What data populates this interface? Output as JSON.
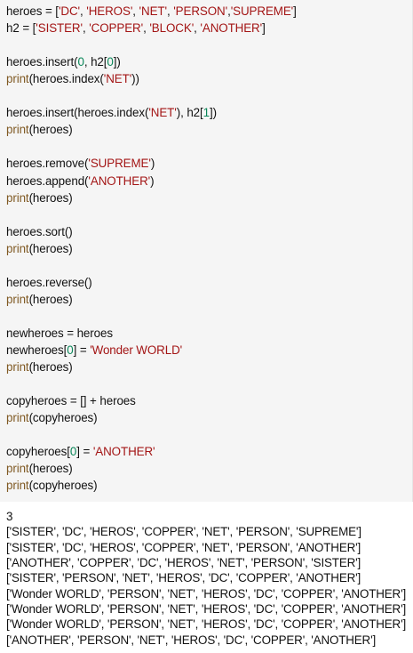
{
  "code": {
    "lines": [
      [
        {
          "t": "heroes = [",
          "c": "plain"
        },
        {
          "t": "'DC'",
          "c": "str"
        },
        {
          "t": ", ",
          "c": "plain"
        },
        {
          "t": "'HEROS'",
          "c": "str"
        },
        {
          "t": ", ",
          "c": "plain"
        },
        {
          "t": "'NET'",
          "c": "str"
        },
        {
          "t": ", ",
          "c": "plain"
        },
        {
          "t": "'PERSON'",
          "c": "str"
        },
        {
          "t": ",",
          "c": "plain"
        },
        {
          "t": "'SUPREME'",
          "c": "str"
        },
        {
          "t": "]",
          "c": "plain"
        }
      ],
      [
        {
          "t": "h2 = [",
          "c": "plain"
        },
        {
          "t": "'SISTER'",
          "c": "str"
        },
        {
          "t": ", ",
          "c": "plain"
        },
        {
          "t": "'COPPER'",
          "c": "str"
        },
        {
          "t": ", ",
          "c": "plain"
        },
        {
          "t": "'BLOCK'",
          "c": "str"
        },
        {
          "t": ", ",
          "c": "plain"
        },
        {
          "t": "'ANOTHER'",
          "c": "str"
        },
        {
          "t": "]",
          "c": "plain"
        }
      ],
      [],
      [
        {
          "t": "heroes.insert(",
          "c": "plain"
        },
        {
          "t": "0",
          "c": "num"
        },
        {
          "t": ", h2[",
          "c": "plain"
        },
        {
          "t": "0",
          "c": "num"
        },
        {
          "t": "])",
          "c": "plain"
        }
      ],
      [
        {
          "t": "print",
          "c": "fn"
        },
        {
          "t": "(heroes.index(",
          "c": "plain"
        },
        {
          "t": "'NET'",
          "c": "str"
        },
        {
          "t": "))",
          "c": "plain"
        }
      ],
      [],
      [
        {
          "t": "heroes.insert(heroes.index(",
          "c": "plain"
        },
        {
          "t": "'NET'",
          "c": "str"
        },
        {
          "t": "), h2[",
          "c": "plain"
        },
        {
          "t": "1",
          "c": "num"
        },
        {
          "t": "])",
          "c": "plain"
        }
      ],
      [
        {
          "t": "print",
          "c": "fn"
        },
        {
          "t": "(heroes)",
          "c": "plain"
        }
      ],
      [],
      [
        {
          "t": "heroes.remove(",
          "c": "plain"
        },
        {
          "t": "'SUPREME'",
          "c": "str"
        },
        {
          "t": ")",
          "c": "plain"
        }
      ],
      [
        {
          "t": "heroes.append(",
          "c": "plain"
        },
        {
          "t": "'ANOTHER'",
          "c": "str"
        },
        {
          "t": ")",
          "c": "plain"
        }
      ],
      [
        {
          "t": "print",
          "c": "fn"
        },
        {
          "t": "(heroes)",
          "c": "plain"
        }
      ],
      [],
      [
        {
          "t": "heroes.sort()",
          "c": "plain"
        }
      ],
      [
        {
          "t": "print",
          "c": "fn"
        },
        {
          "t": "(heroes)",
          "c": "plain"
        }
      ],
      [],
      [
        {
          "t": "heroes.reverse()",
          "c": "plain"
        }
      ],
      [
        {
          "t": "print",
          "c": "fn"
        },
        {
          "t": "(heroes)",
          "c": "plain"
        }
      ],
      [],
      [
        {
          "t": "newheroes = heroes",
          "c": "plain"
        }
      ],
      [
        {
          "t": "newheroes[",
          "c": "plain"
        },
        {
          "t": "0",
          "c": "num"
        },
        {
          "t": "] = ",
          "c": "plain"
        },
        {
          "t": "'Wonder WORLD'",
          "c": "str"
        }
      ],
      [
        {
          "t": "print",
          "c": "fn"
        },
        {
          "t": "(heroes)",
          "c": "plain"
        }
      ],
      [],
      [
        {
          "t": "copyheroes = [] + heroes",
          "c": "plain"
        }
      ],
      [
        {
          "t": "print",
          "c": "fn"
        },
        {
          "t": "(copyheroes)",
          "c": "plain"
        }
      ],
      [],
      [
        {
          "t": "copyheroes[",
          "c": "plain"
        },
        {
          "t": "0",
          "c": "num"
        },
        {
          "t": "] = ",
          "c": "plain"
        },
        {
          "t": "'ANOTHER'",
          "c": "str"
        }
      ],
      [
        {
          "t": "print",
          "c": "fn"
        },
        {
          "t": "(heroes)",
          "c": "plain"
        }
      ],
      [
        {
          "t": "print",
          "c": "fn"
        },
        {
          "t": "(copyheroes)",
          "c": "plain"
        }
      ]
    ]
  },
  "output": {
    "lines": [
      "3",
      "['SISTER', 'DC', 'HEROS', 'COPPER', 'NET', 'PERSON', 'SUPREME']",
      "['SISTER', 'DC', 'HEROS', 'COPPER', 'NET', 'PERSON', 'ANOTHER']",
      "['ANOTHER', 'COPPER', 'DC', 'HEROS', 'NET', 'PERSON', 'SISTER']",
      "['SISTER', 'PERSON', 'NET', 'HEROS', 'DC', 'COPPER', 'ANOTHER']",
      "['Wonder WORLD', 'PERSON', 'NET', 'HEROS', 'DC', 'COPPER', 'ANOTHER']",
      "['Wonder WORLD', 'PERSON', 'NET', 'HEROS', 'DC', 'COPPER', 'ANOTHER']",
      "['Wonder WORLD', 'PERSON', 'NET', 'HEROS', 'DC', 'COPPER', 'ANOTHER']",
      "['ANOTHER', 'PERSON', 'NET', 'HEROS', 'DC', 'COPPER', 'ANOTHER']"
    ]
  },
  "colors": {
    "code_background": "#f5f5f5",
    "string": "#a31515",
    "number": "#098658",
    "builtin": "#805a24",
    "text": "#111111"
  }
}
